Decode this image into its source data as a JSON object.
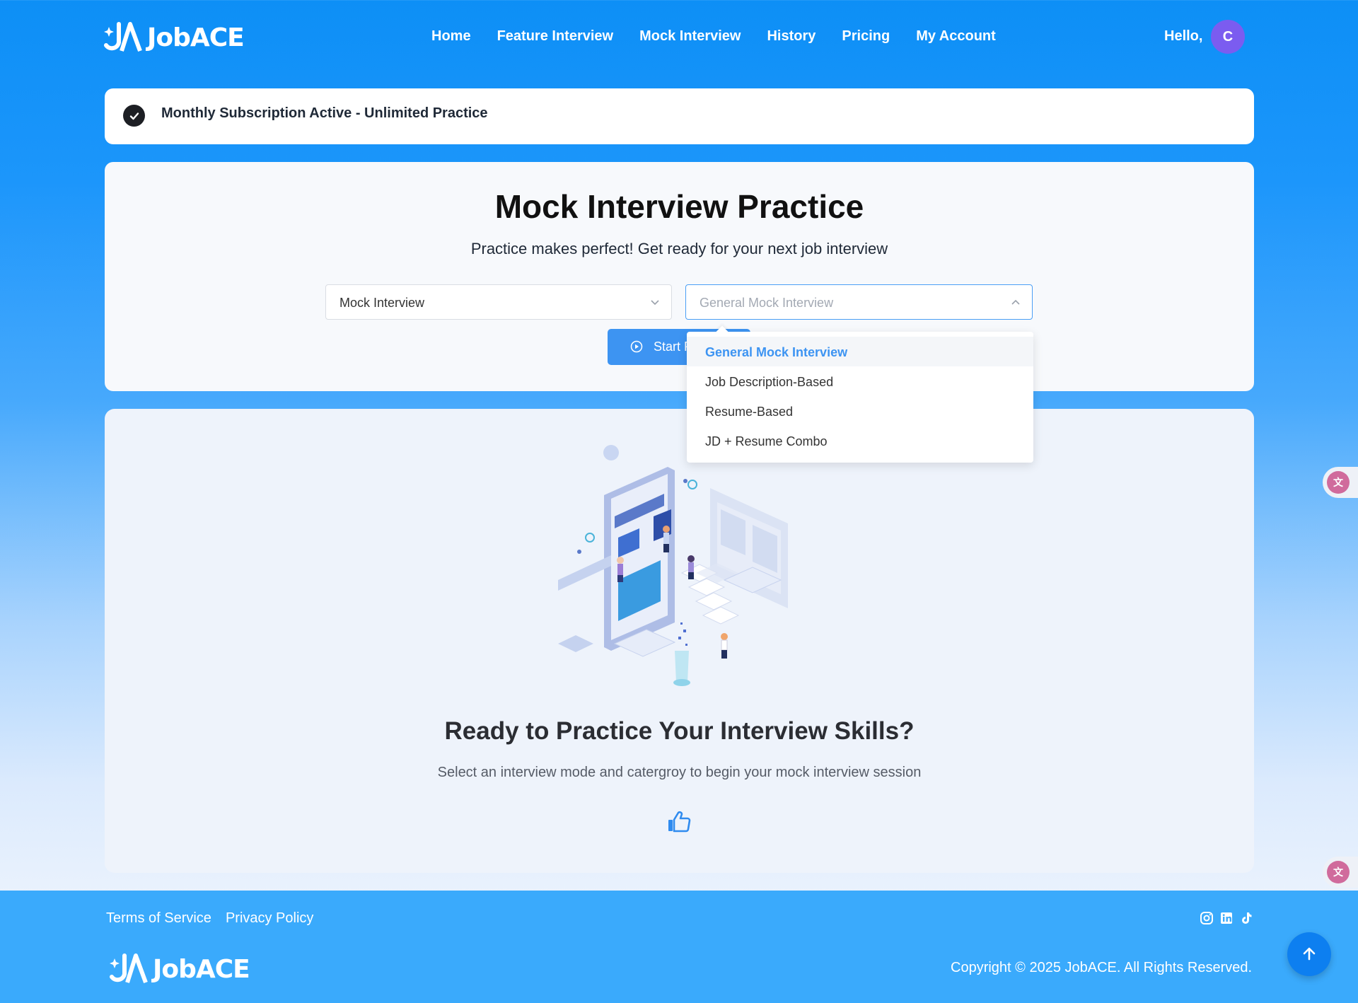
{
  "header": {
    "logo_text": "JobACE",
    "nav": [
      "Home",
      "Feature Interview",
      "Mock Interview",
      "History",
      "Pricing",
      "My Account"
    ],
    "greeting": "Hello,",
    "avatar_initial": "C"
  },
  "subscription": {
    "text": "Monthly Subscription Active - Unlimited Practice"
  },
  "practice": {
    "title": "Mock Interview Practice",
    "subtitle": "Practice makes perfect! Get ready for your next job interview",
    "mode_select": "Mock Interview",
    "category_select": "General Mock Interview",
    "start_button": "Start P",
    "dropdown_options": [
      "General Mock Interview",
      "Job Description-Based",
      "Resume-Based",
      "JD + Resume Combo"
    ]
  },
  "empty_state": {
    "title": "Ready to Practice Your Interview Skills?",
    "subtitle": "Select an interview mode and catergroy to begin your mock interview session"
  },
  "footer": {
    "links": [
      "Terms of Service",
      "Privacy Policy"
    ],
    "logo_text": "JobACE",
    "copyright": "Copyright © 2025 JobACE. All Rights Reserved."
  },
  "colors": {
    "primary": "#3d94f2",
    "header_blue": "#0d8ff6",
    "footer_blue": "#3aaafc",
    "avatar": "#7b5cf0"
  },
  "icons": [
    "check-circle-icon",
    "chevron-down-icon",
    "chevron-up-icon",
    "play-circle-icon",
    "thumbs-up-icon",
    "instagram-icon",
    "linkedin-icon",
    "tiktok-icon",
    "arrow-up-icon",
    "translate-icon"
  ]
}
